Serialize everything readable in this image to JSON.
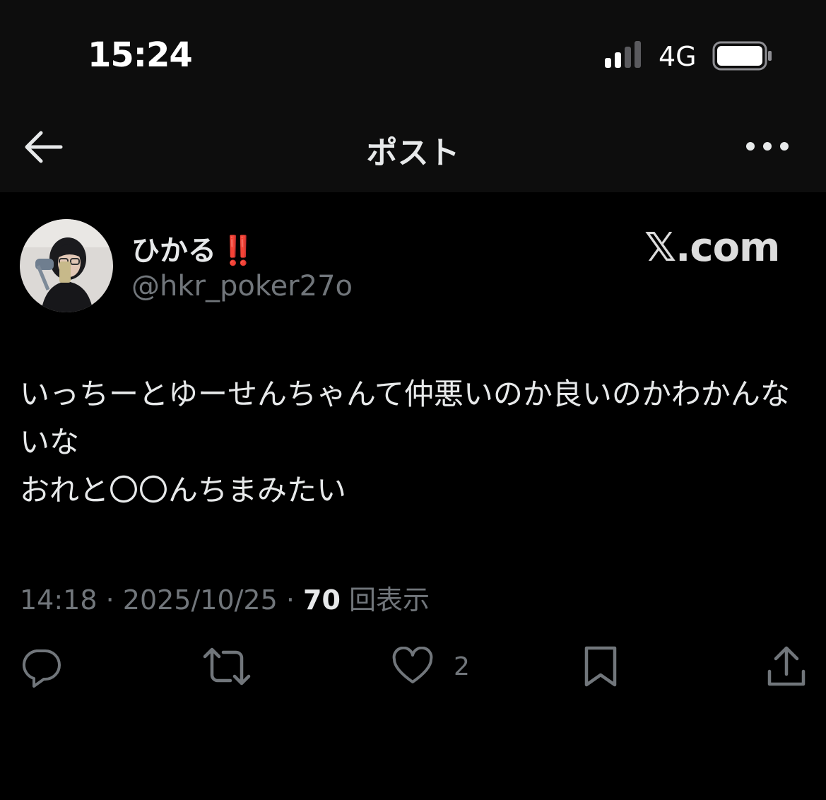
{
  "status_bar": {
    "time": "15:24",
    "network": "4G",
    "signal_icon": "signal-bars-icon",
    "battery_icon": "battery-icon"
  },
  "nav": {
    "back_icon": "arrow-left-icon",
    "title": "ポスト",
    "more_icon": "more-horizontal-icon"
  },
  "author": {
    "display_name": "ひかる",
    "emoji": "‼️",
    "handle": "@hkr_poker27o"
  },
  "watermark": "𝕏.com",
  "post": {
    "text": "いっちーとゆーせんちゃんて仲悪いのか良いのかわかんないな\nおれと〇〇んちまみたい"
  },
  "meta": {
    "time": "14:18",
    "separator": " · ",
    "date": "2025/10/25",
    "views_count": "70",
    "views_label": "回表示"
  },
  "actions": {
    "reply_icon": "reply-bubble-icon",
    "repost_icon": "repost-icon",
    "like_icon": "heart-icon",
    "like_count": "2",
    "bookmark_icon": "bookmark-icon",
    "share_icon": "share-icon"
  },
  "colors": {
    "background": "#000000",
    "header_background": "#0d0d0d",
    "text_primary": "#e7e9ea",
    "text_secondary": "#71767b",
    "emoji_red": "#e0242f"
  }
}
